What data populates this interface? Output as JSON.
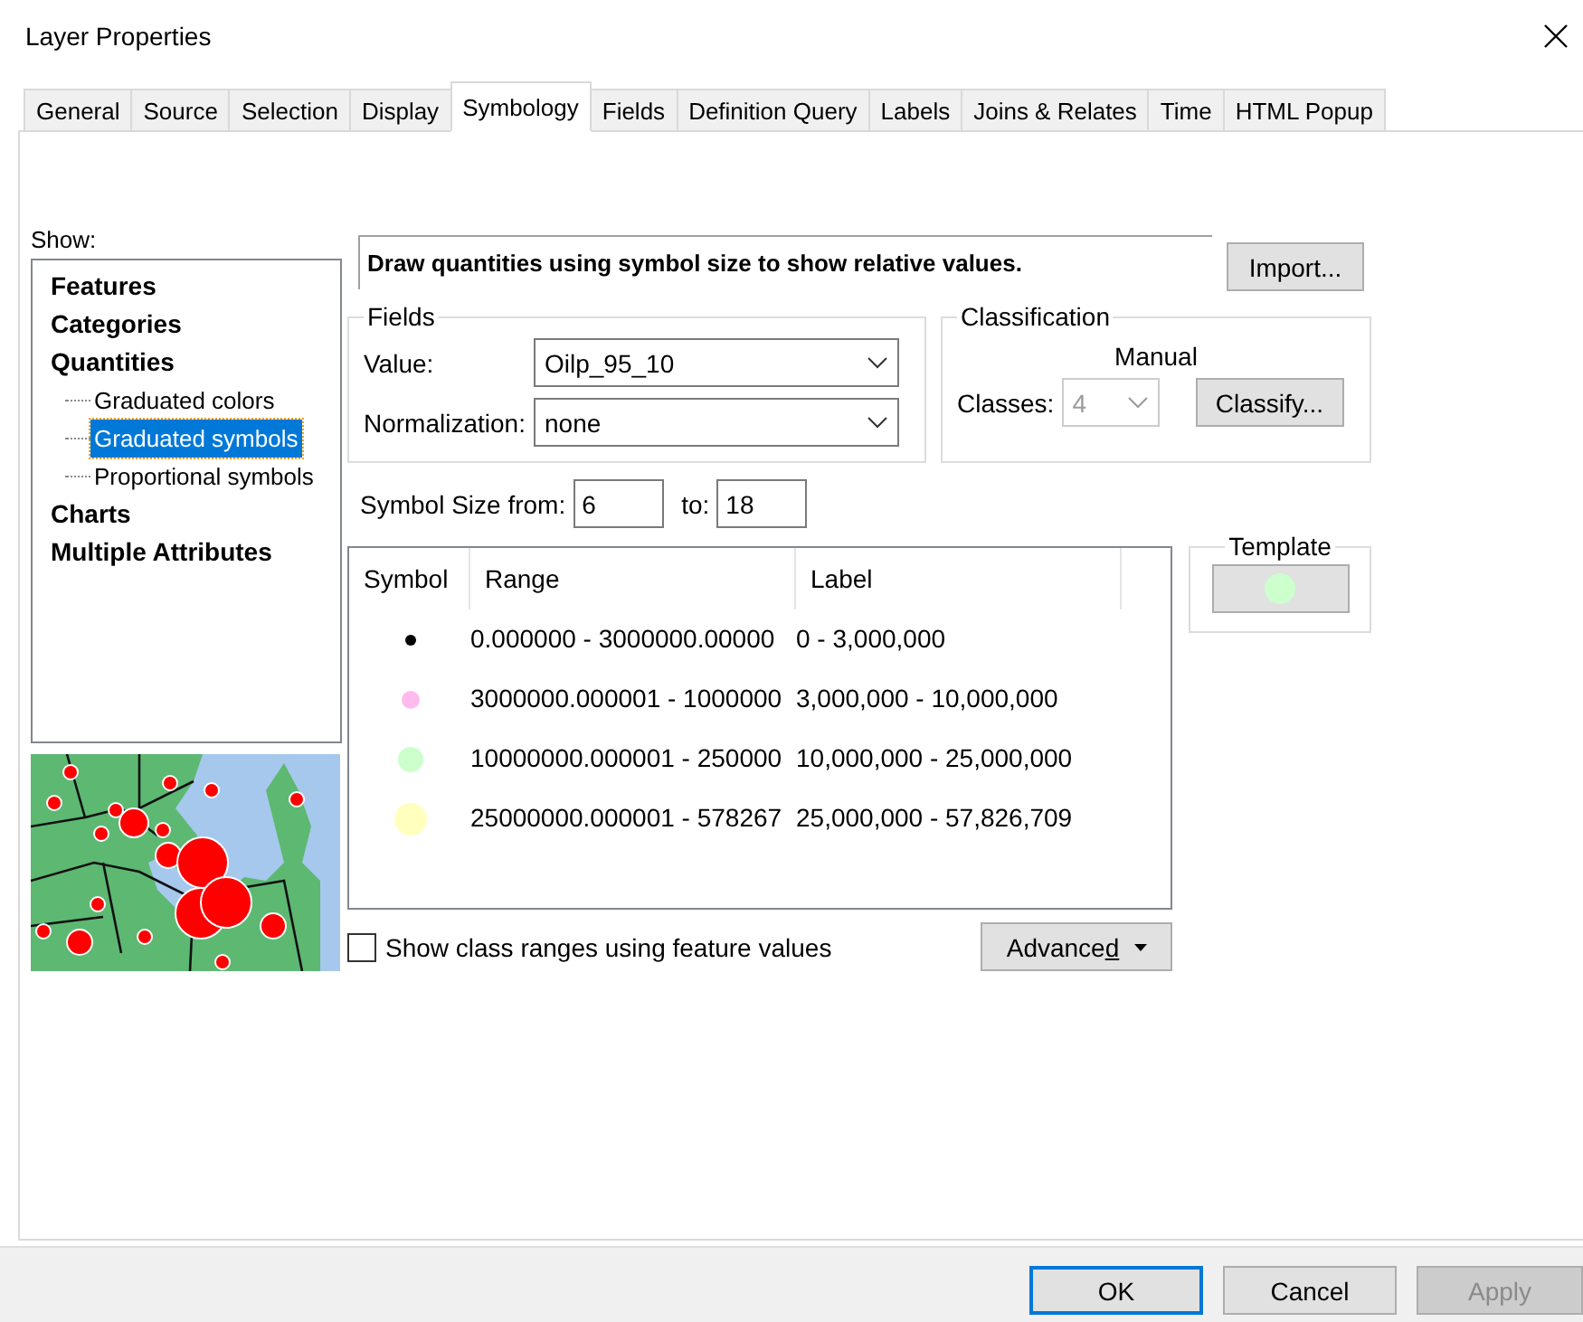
{
  "window": {
    "title": "Layer Properties"
  },
  "tabs": [
    {
      "label": "General",
      "selected": false
    },
    {
      "label": "Source",
      "selected": false
    },
    {
      "label": "Selection",
      "selected": false
    },
    {
      "label": "Display",
      "selected": false
    },
    {
      "label": "Symbology",
      "selected": true
    },
    {
      "label": "Fields",
      "selected": false
    },
    {
      "label": "Definition Query",
      "selected": false
    },
    {
      "label": "Labels",
      "selected": false
    },
    {
      "label": "Joins & Relates",
      "selected": false
    },
    {
      "label": "Time",
      "selected": false
    },
    {
      "label": "HTML Popup",
      "selected": false
    }
  ],
  "show": {
    "label": "Show:",
    "items": [
      {
        "label": "Features",
        "selected": false
      },
      {
        "label": "Categories",
        "selected": false
      },
      {
        "label": "Quantities",
        "selected": false,
        "children": [
          {
            "label": "Graduated colors",
            "selected": false
          },
          {
            "label": "Graduated symbols",
            "selected": true
          },
          {
            "label": "Proportional symbols",
            "selected": false
          }
        ]
      },
      {
        "label": "Charts",
        "selected": false
      },
      {
        "label": "Multiple Attributes",
        "selected": false
      }
    ]
  },
  "description": "Draw quantities using symbol size to show relative values.",
  "import_button": "Import...",
  "fields": {
    "title": "Fields",
    "value_label": "Value:",
    "value": "Oilp_95_10",
    "normalization_label": "Normalization:",
    "normalization": "none"
  },
  "classification": {
    "title": "Classification",
    "method": "Manual",
    "classes_label": "Classes:",
    "classes": "4",
    "classes_disabled": true,
    "classify_button": "Classify..."
  },
  "symbol_size": {
    "from_label": "Symbol Size from:",
    "from": "6",
    "to_label": "to:",
    "to": "18"
  },
  "legend": {
    "columns": [
      "Symbol",
      "Range",
      "Label"
    ],
    "rows": [
      {
        "color": "#000000",
        "range": "0.000000 - 3000000.00000",
        "label": "0 - 3,000,000"
      },
      {
        "color": "#ffbbee",
        "range": "3000000.000001 - 1000000",
        "label": "3,000,000 - 10,000,000"
      },
      {
        "color": "#ccffcc",
        "range": "10000000.000001 - 250000",
        "label": "10,000,000 - 25,000,000"
      },
      {
        "color": "#ffffbe",
        "range": "25000000.000001 - 578267",
        "label": "25,000,000 - 57,826,709"
      }
    ]
  },
  "template": {
    "title": "Template",
    "color": "#ccffcc"
  },
  "class_ranges_checkbox": {
    "label": "Show class ranges using feature values",
    "checked": false
  },
  "advanced_button": {
    "label": "Advanced"
  },
  "buttons": [
    {
      "label": "OK",
      "kind": "default",
      "disabled": false
    },
    {
      "label": "Cancel",
      "kind": "normal",
      "disabled": false
    },
    {
      "label": "Apply",
      "kind": "normal",
      "disabled": true
    }
  ]
}
